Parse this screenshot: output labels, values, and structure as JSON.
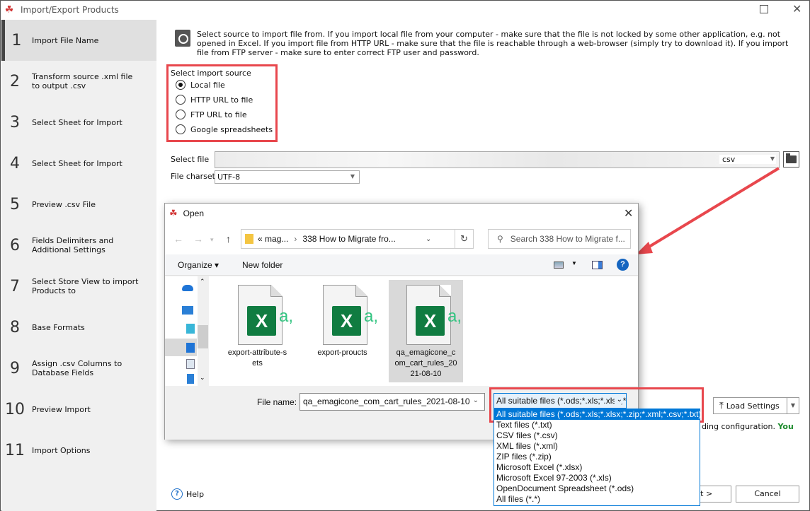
{
  "window": {
    "title": "Import/Export Products"
  },
  "sidebar": {
    "steps": [
      {
        "num": "1",
        "label": "Import File Name",
        "active": true
      },
      {
        "num": "2",
        "label": "Transform source .xml file to output .csv"
      },
      {
        "num": "3",
        "label": "Select Sheet for Import"
      },
      {
        "num": "4",
        "label": "Select Sheet for Import"
      },
      {
        "num": "5",
        "label": "Preview .csv File"
      },
      {
        "num": "6",
        "label": "Fields Delimiters and Additional Settings"
      },
      {
        "num": "7",
        "label": "Select Store View to import Products to"
      },
      {
        "num": "8",
        "label": "Base Formats"
      },
      {
        "num": "9",
        "label": "Assign .csv Columns to Database Fields"
      },
      {
        "num": "10",
        "label": "Preview Import"
      },
      {
        "num": "11",
        "label": "Import Options"
      }
    ]
  },
  "main": {
    "info_text": "Select source to import file from. If you import local file from your computer - make sure that the file is not locked by some other application, e.g. not opened in Excel. If you import file from HTTP URL - make sure that the file is reachable through a web-browser (simply try to download it). If you import file from FTP server - make sure to enter correct FTP user and password.",
    "source_title": "Select import source",
    "sources": [
      {
        "label": "Local file",
        "checked": true
      },
      {
        "label": "HTTP URL to file",
        "checked": false
      },
      {
        "label": "FTP URL to file",
        "checked": false
      },
      {
        "label": "Google spreadsheets",
        "checked": false
      }
    ],
    "select_file_label": "Select file",
    "select_file_ext": "csv",
    "charset_label": "File charset",
    "charset_value": "UTF-8",
    "load_settings": "Load Settings",
    "note_text": "ding configuration.",
    "note_green": "You",
    "help": "Help",
    "next": "Next >",
    "cancel": "Cancel"
  },
  "dialog": {
    "title": "Open",
    "path_prefix": "«",
    "path_parent": "mag...",
    "path_current": "338 How to Migrate fro...",
    "search_placeholder": "Search 338 How to Migrate f...",
    "organize": "Organize ▾",
    "new_folder": "New folder",
    "files": [
      {
        "name": "export-attribute-sets",
        "selected": false
      },
      {
        "name": "export-proucts",
        "selected": false
      },
      {
        "name": "qa_emagicone_com_cart_rules_2021-08-10",
        "selected": true
      }
    ],
    "file_name_label": "File name:",
    "file_name_value": "qa_emagicone_com_cart_rules_2021-08-10",
    "filter_selected": "All suitable files (*.ods;*.xls;*.xlsx;*.zip;*.xml;*.csv;*.txt)",
    "filter_options": [
      "All suitable files (*.ods;*.xls;*.xlsx;*.zip;*.xml;*.csv;*.txt)",
      "Text files (*.txt)",
      "CSV files (*.csv)",
      "XML files (*.xml)",
      "ZIP files (*.zip)",
      "Microsoft Excel (*.xlsx)",
      "Microsoft Excel 97-2003 (*.xls)",
      "OpenDocument Spreadsheet (*.ods)",
      "All files (*.*)"
    ]
  },
  "colors": {
    "accent": "#0078d7",
    "highlight_box": "#e8474d",
    "excel_green": "#107c41"
  }
}
